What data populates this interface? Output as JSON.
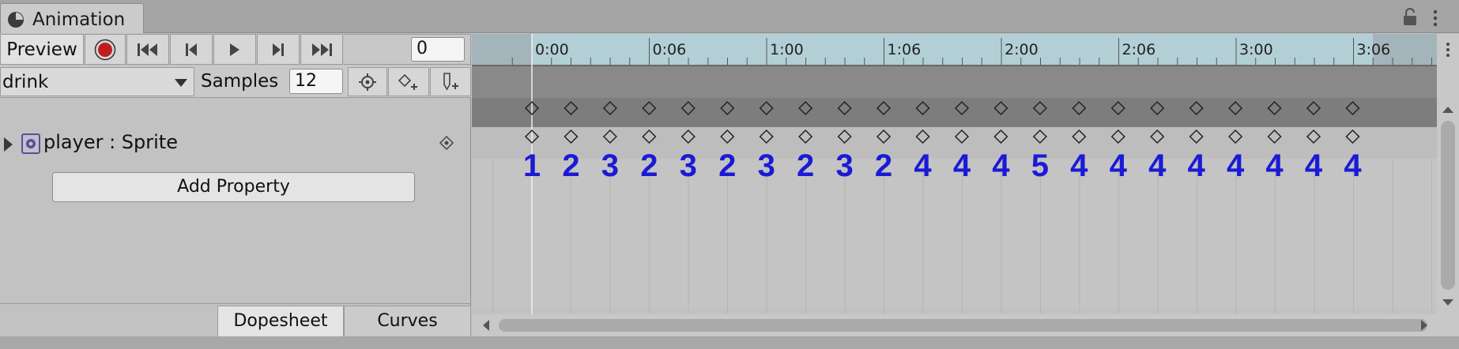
{
  "window": {
    "tab_title": "Animation"
  },
  "toolbar": {
    "preview_label": "Preview",
    "frame_value": "0"
  },
  "clip": {
    "name": "drink",
    "samples_label": "Samples",
    "samples_value": "12"
  },
  "property": {
    "label": "player : Sprite"
  },
  "actions": {
    "add_property_label": "Add Property"
  },
  "view_tabs": {
    "dopesheet": "Dopesheet",
    "curves": "Curves"
  },
  "timeline": {
    "ruler_labels": [
      "0:00",
      "0:06",
      "1:00",
      "1:06",
      "2:00",
      "2:06",
      "3:00",
      "3:06"
    ],
    "keyframe_count": 22,
    "frame_annotations": [
      "1",
      "2",
      "3",
      "2",
      "3",
      "2",
      "3",
      "2",
      "3",
      "2",
      "4",
      "4",
      "4",
      "5",
      "4",
      "4",
      "4",
      "4",
      "4",
      "4",
      "4",
      "4"
    ]
  },
  "colors": {
    "annotation": "#1a1ad6",
    "ruler": "#b3cfd6",
    "record": "#c21d1d"
  }
}
